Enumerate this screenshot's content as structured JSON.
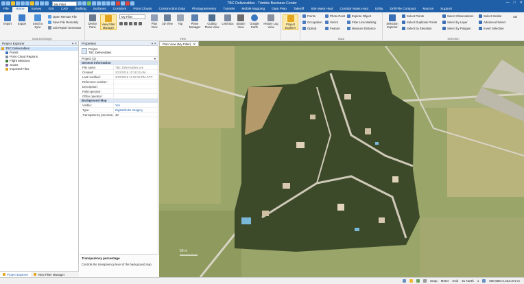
{
  "app": {
    "title": "TBC Deliverables - Trimble Business Center",
    "filter_name": "My Filter"
  },
  "tabs": [
    "File",
    "Home",
    "Survey",
    "GIS",
    "CAD",
    "Drafting",
    "Surfaces",
    "Corridors",
    "Point Clouds",
    "Construction Data",
    "Photogrammetry",
    "Tunnels",
    "Mobile Mapping",
    "Data Prep",
    "Takeoff",
    "Site Mass Haul",
    "Corridor Mass Haul",
    "Utility",
    "Drill File Compact",
    "Macros",
    "Support"
  ],
  "active_tab": "Home",
  "ribbon": {
    "data_exchange": {
      "label": "Data Exchange",
      "import": "Import",
      "export": "Export",
      "send_to_sync": "Send to Sync",
      "open_remote": "Open Remote File",
      "save_remote": "Save File Remotely",
      "job_report": "Job Report Generator"
    },
    "view": {
      "label": "View",
      "device_pane": "Device Pane",
      "view_filter_manager": "View Filter Manager",
      "filter_value": "My Filter",
      "plan_view": "Plan View",
      "view_3d": "3D View",
      "top": "Top",
      "plane_manager": "Plane Manager",
      "cutting_plane_view": "Cutting Plane View",
      "limit_box": "Limit Box",
      "station_view": "Station View",
      "google_earth": "Google Earth",
      "history_log_view": "History Log View"
    },
    "project": {
      "label": "",
      "project_explorer": "Project Explorer"
    },
    "data": {
      "label": "Data",
      "points": "Points",
      "occupation": "Occupation",
      "optical": "Optical",
      "photo_point": "Photo Point",
      "vector": "Vector",
      "feature": "Feature",
      "explore_object": "Explore Object",
      "filter_line_marking": "Filter Line Marking",
      "measure_distance": "Measure Distance"
    },
    "selection": {
      "label": "Selection",
      "selection_explorer": "Selection Explorer",
      "select_points": "Select Points",
      "select_duplicate_points": "Select Duplicate Points",
      "select_by_elevation": "Select by Elevation",
      "select_observations": "Select Observations",
      "select_by_layer": "Select by Layer",
      "select_by_polygon": "Select by Polygon",
      "select_similar": "Select Similar",
      "advanced_select": "Advanced Select",
      "invert_selection": "Invert Selection",
      "sel_overflow": "Sel"
    }
  },
  "project_explorer": {
    "title": "Project Explorer",
    "items": [
      {
        "label": "TBC Deliverables",
        "selected": true
      },
      {
        "label": "Points"
      },
      {
        "label": "Point Cloud Regions"
      },
      {
        "label": "Flight Missions"
      },
      {
        "label": "Scans"
      },
      {
        "label": "Imported Files"
      }
    ],
    "bottom_tabs": [
      "Project Explorer",
      "View Filter Manager"
    ]
  },
  "properties": {
    "title": "Properties",
    "object_type": "Project",
    "object_name": "TBC Deliverables",
    "selector": "Project (1)",
    "general_section": "General Information",
    "general": [
      {
        "k": "File name:",
        "v": "TBC Deliverables.vce"
      },
      {
        "k": "Created:",
        "v": "3/22/2019 10:28:20 AM"
      },
      {
        "k": "Last modified:",
        "v": "3/22/2019 11:56:29 PM GTC"
      },
      {
        "k": "Reference number:",
        "v": ""
      },
      {
        "k": "Description:",
        "v": ""
      },
      {
        "k": "Field operator:",
        "v": ""
      },
      {
        "k": "Office operator:",
        "v": ""
      }
    ],
    "bg_section": "Background Map",
    "background": [
      {
        "k": "Visible:",
        "v": "Yes"
      },
      {
        "k": "Type:",
        "v": "DigitalGlobe Imagery"
      },
      {
        "k": "Transparency percenta",
        "v": "40"
      }
    ],
    "desc_title": "Transparency percentage",
    "desc_body": "Controls the transparency level of the background map"
  },
  "map": {
    "tab_label": "Plan View (My Filter)",
    "scale_label": "50 m",
    "colors": {
      "field": "#8f9a5c",
      "dense": "#3d4a2a",
      "road": "#d8d4c4"
    }
  },
  "status": {
    "snap": "Snap",
    "units": "Meter",
    "grid": "Grid",
    "zone": "31 North",
    "page": "1",
    "coords": "660.586 m,423.372 m"
  }
}
